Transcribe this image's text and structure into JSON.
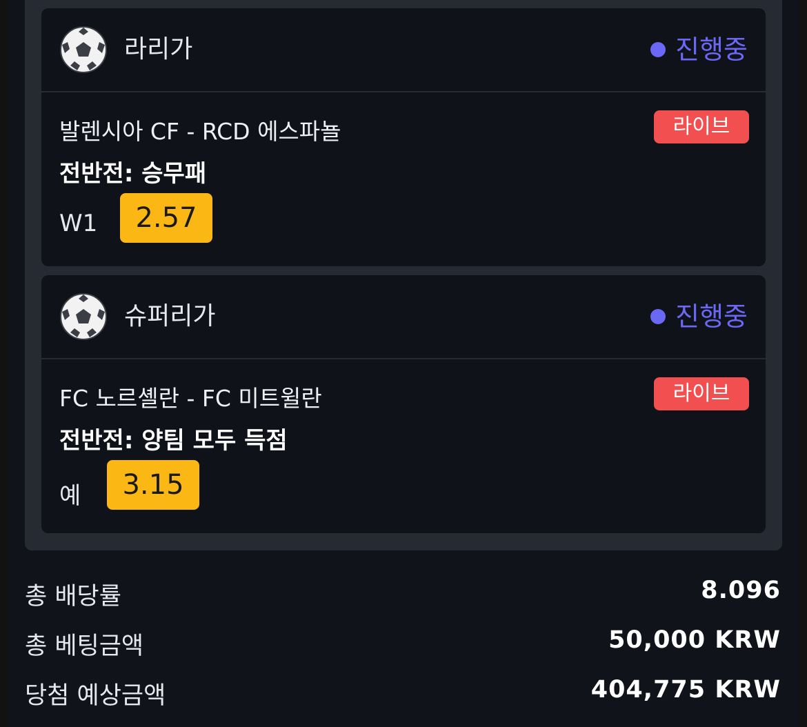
{
  "bets": [
    {
      "league": "라리가",
      "status": "진행중",
      "match": "발렌시아 CF - RCD 에스파뇰",
      "live_badge": "라이브",
      "market": "전반전: 승무패",
      "pick": "W1",
      "odds": "2.57"
    },
    {
      "league": "슈퍼리가",
      "status": "진행중",
      "match": "FC 노르셸란 - FC 미트윌란",
      "live_badge": "라이브",
      "market": "전반전: 양팀 모두 득점",
      "pick": "예",
      "odds": "3.15"
    }
  ],
  "summary": {
    "total_odds_label": "총 배당률",
    "total_odds_value": "8.096",
    "total_stake_label": "총 베팅금액",
    "total_stake_value": "50,000 KRW",
    "potential_win_label": "당첨 예상금액",
    "potential_win_value": "404,775 KRW"
  },
  "colors": {
    "status_accent": "#6b68f5",
    "live_badge": "#f25050",
    "odds_button": "#fbb713"
  },
  "icons": {
    "sport": "soccer-ball-icon"
  }
}
